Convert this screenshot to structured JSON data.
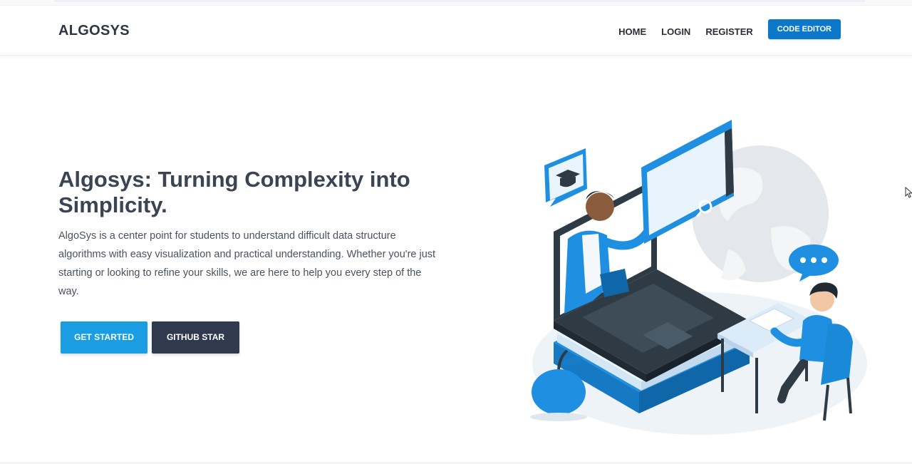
{
  "brand": {
    "name": "ALGOSYS"
  },
  "nav": {
    "items": [
      {
        "label": "HOME"
      },
      {
        "label": "LOGIN"
      },
      {
        "label": "REGISTER"
      }
    ],
    "cta_label": "CODE EDITOR"
  },
  "hero": {
    "title": "Algosys: Turning Complexity into Simplicity.",
    "description": "AlgoSys is a center point for students to understand difficult data structure algorithms with easy visualization and practical understanding. Whether you're just starting or looking to refine your skills, we are here to help you every step of the way.",
    "primary_button": "GET STARTED",
    "secondary_button": "GITHUB STAR"
  },
  "colors": {
    "accent": "#0b78c9",
    "primary_button": "#1a9de3",
    "dark_button": "#2f3a4e",
    "illustration_blue": "#1e8fe1",
    "illustration_dark": "#2e3b45"
  },
  "illustration": {
    "icons": [
      "graduation-cap-icon",
      "chat-bubble-icon",
      "search-icon",
      "apple-icon",
      "globe-icon"
    ]
  }
}
